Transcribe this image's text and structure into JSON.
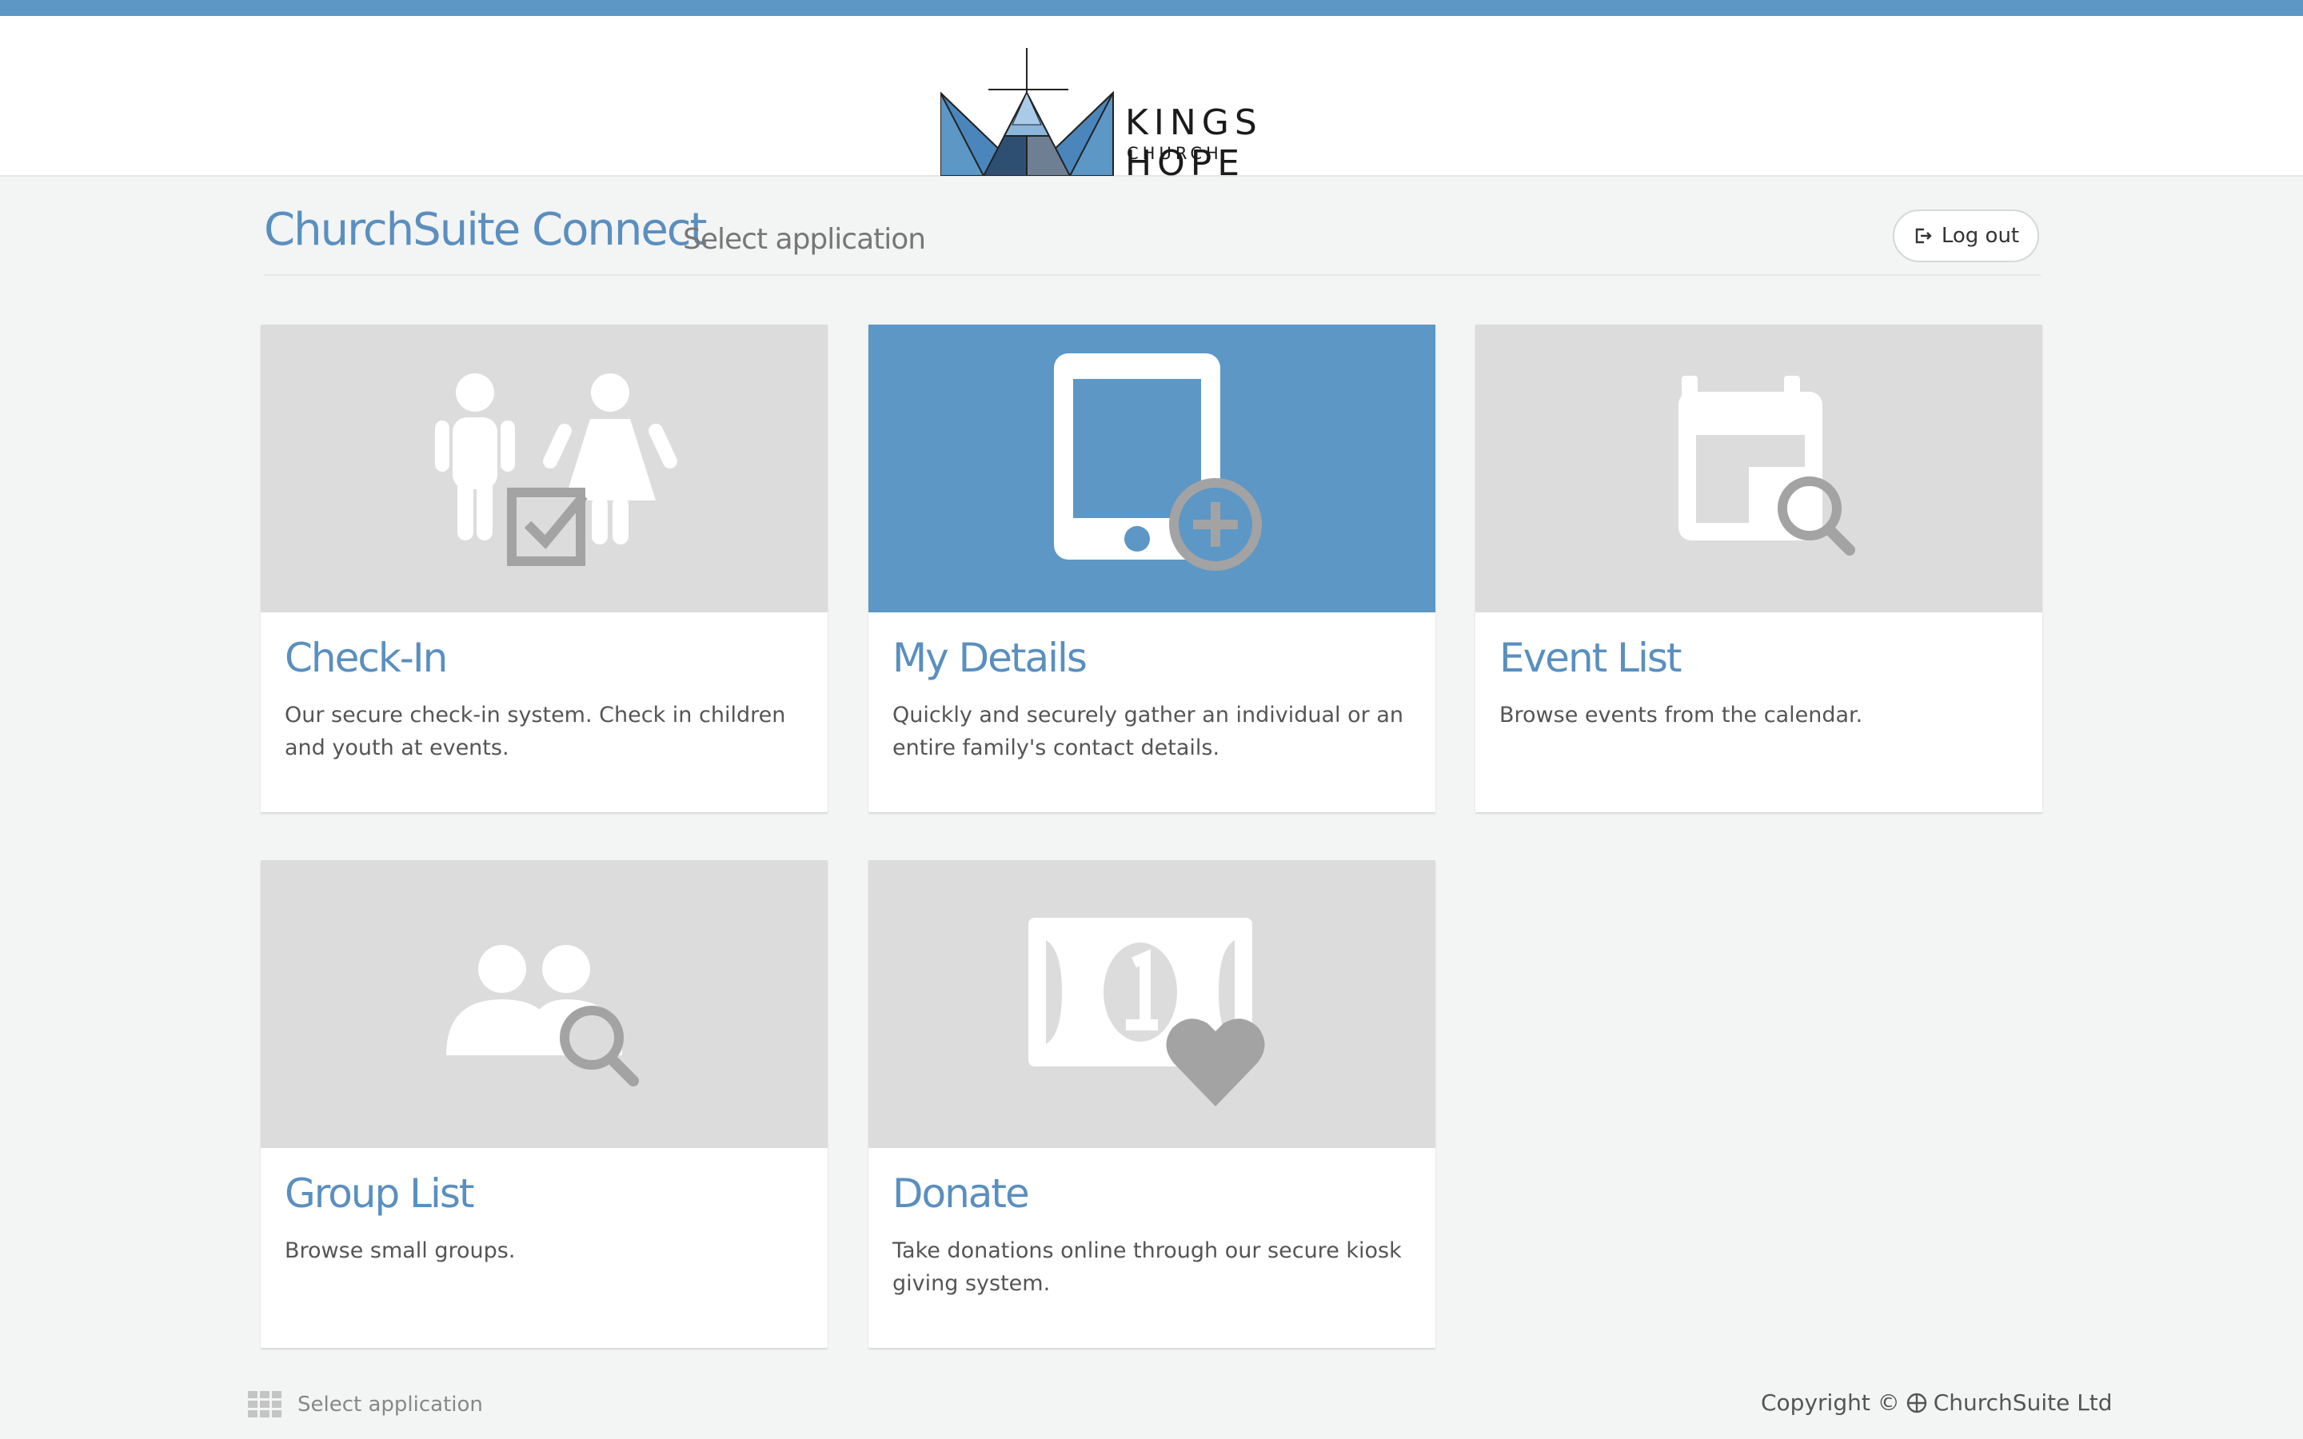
{
  "brand": {
    "name_main": "KINGS HOPE",
    "name_sub": "CHURCH",
    "accent": "#5c97c6"
  },
  "header": {
    "title": "ChurchSuite Connect",
    "subtitle": "Select application",
    "logout_label": "Log out"
  },
  "apps": [
    {
      "title": "Check-In",
      "description": "Our secure check-in system. Check in children and youth at events.",
      "icon": "children-check-icon",
      "active": false
    },
    {
      "title": "My Details",
      "description": "Quickly and securely gather an individual or an entire family's contact details.",
      "icon": "tablet-add-icon",
      "active": true
    },
    {
      "title": "Event List",
      "description": "Browse events from the calendar.",
      "icon": "calendar-search-icon",
      "active": false
    },
    {
      "title": "Group List",
      "description": "Browse small groups.",
      "icon": "group-search-icon",
      "active": false
    },
    {
      "title": "Donate",
      "description": "Take donations online through our secure kiosk giving system.",
      "icon": "banknote-heart-icon",
      "active": false
    }
  ],
  "footer": {
    "select_label": "Select application",
    "copyright_prefix": "Copyright ©",
    "copyright_company": "ChurchSuite Ltd"
  }
}
